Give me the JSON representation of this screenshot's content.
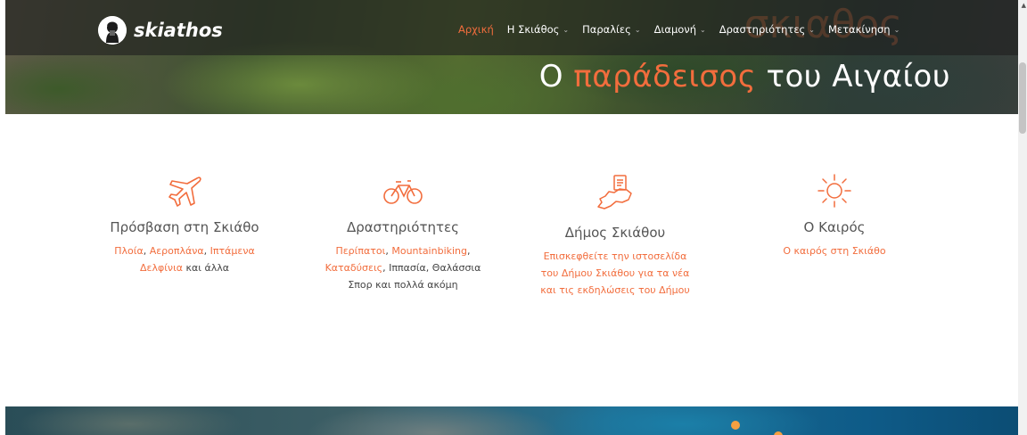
{
  "logo": {
    "text": "skiathos"
  },
  "nav": {
    "items": [
      {
        "label": "Αρχική",
        "active": true,
        "dropdown": false
      },
      {
        "label": "Η Σκιάθος",
        "active": false,
        "dropdown": true
      },
      {
        "label": "Παραλίες",
        "active": false,
        "dropdown": true
      },
      {
        "label": "Διαμονή",
        "active": false,
        "dropdown": true
      },
      {
        "label": "Δραστηριότητες",
        "active": false,
        "dropdown": true
      },
      {
        "label": "Μετακίνηση",
        "active": false,
        "dropdown": true
      }
    ],
    "caret": "⌄"
  },
  "hero": {
    "title_prefix": "Ο",
    "title_accent": "παράδεισος",
    "title_suffix": "του Αιγαίου"
  },
  "features": [
    {
      "icon": "airplane-icon",
      "title": "Πρόσβαση στη Σκιάθο",
      "links": [
        "Πλοία",
        "Αεροπλάνα",
        "Ιπτάμενα Δελφίνια"
      ],
      "sep1": ", ",
      "sep2": ", ",
      "tail": " και άλλα"
    },
    {
      "icon": "bicycle-icon",
      "title": "Δραστηριότητες",
      "links": [
        "Περίπατοι",
        "Mountainbiking",
        "Καταδύσεις"
      ],
      "sep1": ", ",
      "sep2": ", ",
      "tail": ", Ιππασία, Θαλάσσια Σπορ και πολλά ακόμη"
    },
    {
      "icon": "island-map-icon",
      "title": "Δήμος Σκιάθου",
      "text": "Επισκεφθείτε την ιστοσελίδα του Δήμου Σκιάθου για τα νέα και τις εκδηλώσεις του Δήμου"
    },
    {
      "icon": "sun-icon",
      "title": "Ο Καιρός",
      "text": "Ο καιρός στη Σκιάθο"
    }
  ],
  "colors": {
    "accent": "#f26d3d",
    "text": "#555555",
    "nav_bg": "#2a2a2a"
  }
}
